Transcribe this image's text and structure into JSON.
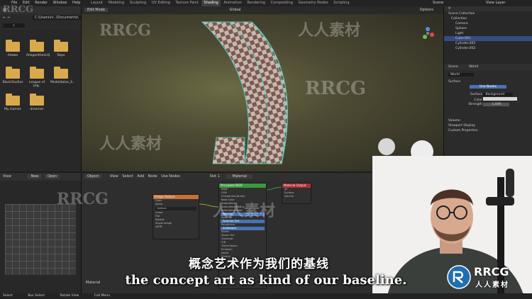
{
  "top_menu": [
    "File",
    "Edit",
    "Render",
    "Window",
    "Help"
  ],
  "workspace_tabs": [
    "Layout",
    "Modeling",
    "Sculpting",
    "UV Editing",
    "Texture Paint",
    "Shading",
    "Animation",
    "Rendering",
    "Compositing",
    "Geometry Nodes",
    "Scripting"
  ],
  "active_workspace": "Shading",
  "scene_field": "Scene",
  "view_layer_field": "View Layer",
  "file_browser": {
    "path": "C:\\Users\\ni..\\Documents\\",
    "folders": [
      "Adobe",
      "AllegorithmicQ",
      "Dsps",
      "BlackStudios",
      "League of Leg..",
      "Modeldatas_S..",
      "My Games",
      "dreamer"
    ]
  },
  "viewport": {
    "mode": "Edit Mode",
    "shading": "Global",
    "options": "Options"
  },
  "outliner": {
    "title": "Scene Collection",
    "items": [
      "Collection",
      "Camera",
      "Sphere",
      "Light",
      "Cube.001",
      "Cylinder.002",
      "Cylinder.002"
    ]
  },
  "properties": {
    "tabs": [
      "Scene",
      "World"
    ],
    "world_name": "World",
    "section_surface": "Surface",
    "use_nodes": "Use Nodes",
    "surface_label": "Surface",
    "surface_value": "Background",
    "color_label": "Color",
    "strength_label": "Strength",
    "strength_value": "1.000",
    "sections": [
      "Volume",
      "Viewport Display",
      "Custom Properties"
    ]
  },
  "image_editor": {
    "view": "View",
    "new": "New",
    "open": "Open"
  },
  "node_editor": {
    "object": "Object",
    "view": "View",
    "select": "Select",
    "add": "Add",
    "node": "Node",
    "use_nodes": "Use Nodes",
    "slot": "Slot 1",
    "material": "Material",
    "footer": "Material",
    "nodes": [
      {
        "name": "Image Texture",
        "color": "#c6703a"
      },
      {
        "name": "Principled BSDF",
        "color": "#3a9a3a"
      },
      {
        "name": "Material Output",
        "color": "#b03030"
      }
    ]
  },
  "statusbar": [
    "Select",
    "Box Select",
    "Rotate View",
    "Call Menu"
  ],
  "subtitles": {
    "cn": "概念艺术作为我们的基线",
    "en": "the concept art as kind of our baseline."
  },
  "watermarks": {
    "brand": "RRCG",
    "cn": "人人素材"
  },
  "colors": {
    "accent_select": "#334d80",
    "folder": "#d9a94d",
    "uv_edge": "#4fd6c4"
  }
}
